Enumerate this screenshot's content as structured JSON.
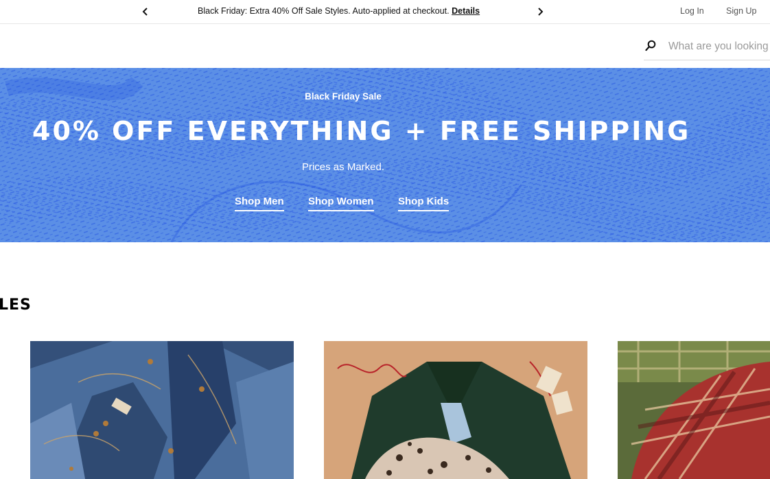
{
  "promo": {
    "message": "Black Friday: Extra 40% Off Sale Styles. Auto-applied at checkout.",
    "link_label": "Details",
    "prev_icon": "chevron-left-icon",
    "next_icon": "chevron-right-icon"
  },
  "account": {
    "login_label": "Log In",
    "signup_label": "Sign Up"
  },
  "search": {
    "placeholder": "What are you looking for?",
    "icon": "search-icon"
  },
  "hero": {
    "eyebrow": "Black Friday Sale",
    "title": "40% OFF EVERYTHING + FREE SHIPPING",
    "subtitle": "Prices as Marked.",
    "ctas": [
      {
        "label": "Shop Men"
      },
      {
        "label": "Shop Women"
      },
      {
        "label": "Shop Kids"
      }
    ],
    "background_color": "#5a8fe8",
    "texture_color": "#1f4fe0"
  },
  "section": {
    "heading_visible": "LES"
  },
  "tiles": [
    {
      "subject": "denim-jeans-image"
    },
    {
      "subject": "green-sherpa-fleece-image"
    },
    {
      "subject": "plaid-flannel-shirts-image"
    }
  ]
}
